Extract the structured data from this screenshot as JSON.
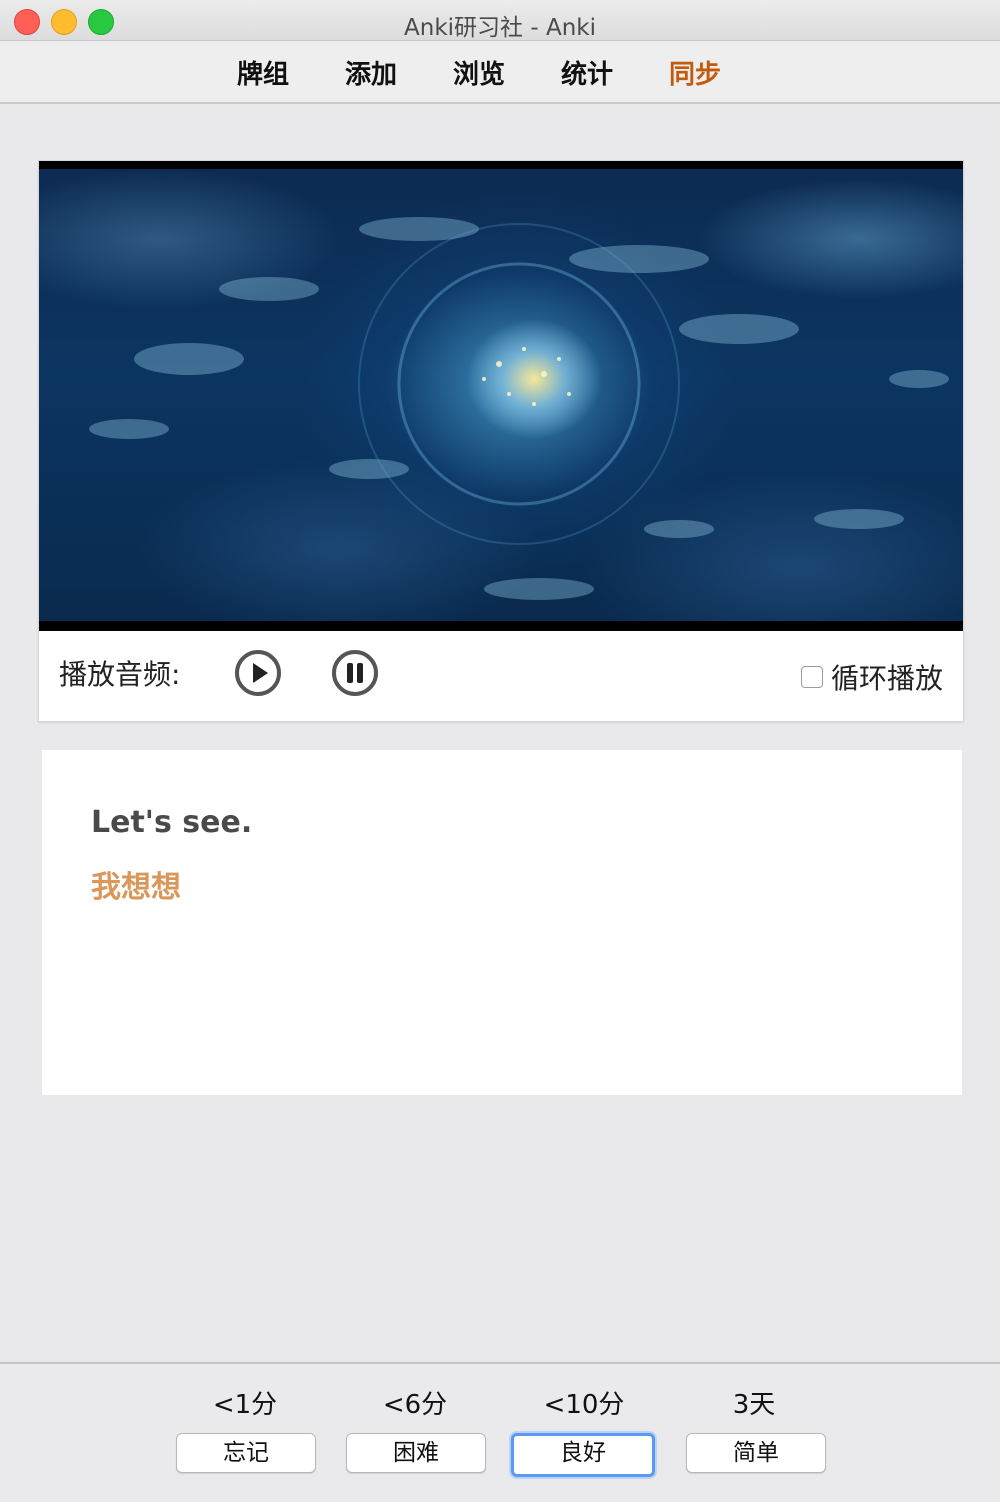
{
  "window": {
    "title": "Anki研习社 - Anki"
  },
  "toolbar": {
    "items": [
      {
        "label": "牌组"
      },
      {
        "label": "添加"
      },
      {
        "label": "浏览"
      },
      {
        "label": "统计"
      },
      {
        "label": "同步",
        "highlight_color": "#c35a0c"
      }
    ]
  },
  "media": {
    "audio_label": "播放音频:",
    "play_icon": "play-circle-icon",
    "pause_icon": "pause-circle-icon",
    "loop_label": "循环播放",
    "loop_checked": false
  },
  "card": {
    "english": "Let's see.",
    "chinese": "我想想",
    "chinese_color": "#d9985a"
  },
  "answer_bar": {
    "buttons": [
      {
        "interval": "<1分",
        "label": "忘记"
      },
      {
        "interval": "<6分",
        "label": "困难"
      },
      {
        "interval": "<10分",
        "label": "良好",
        "focused": true
      },
      {
        "interval": "3天",
        "label": "简单"
      }
    ]
  }
}
